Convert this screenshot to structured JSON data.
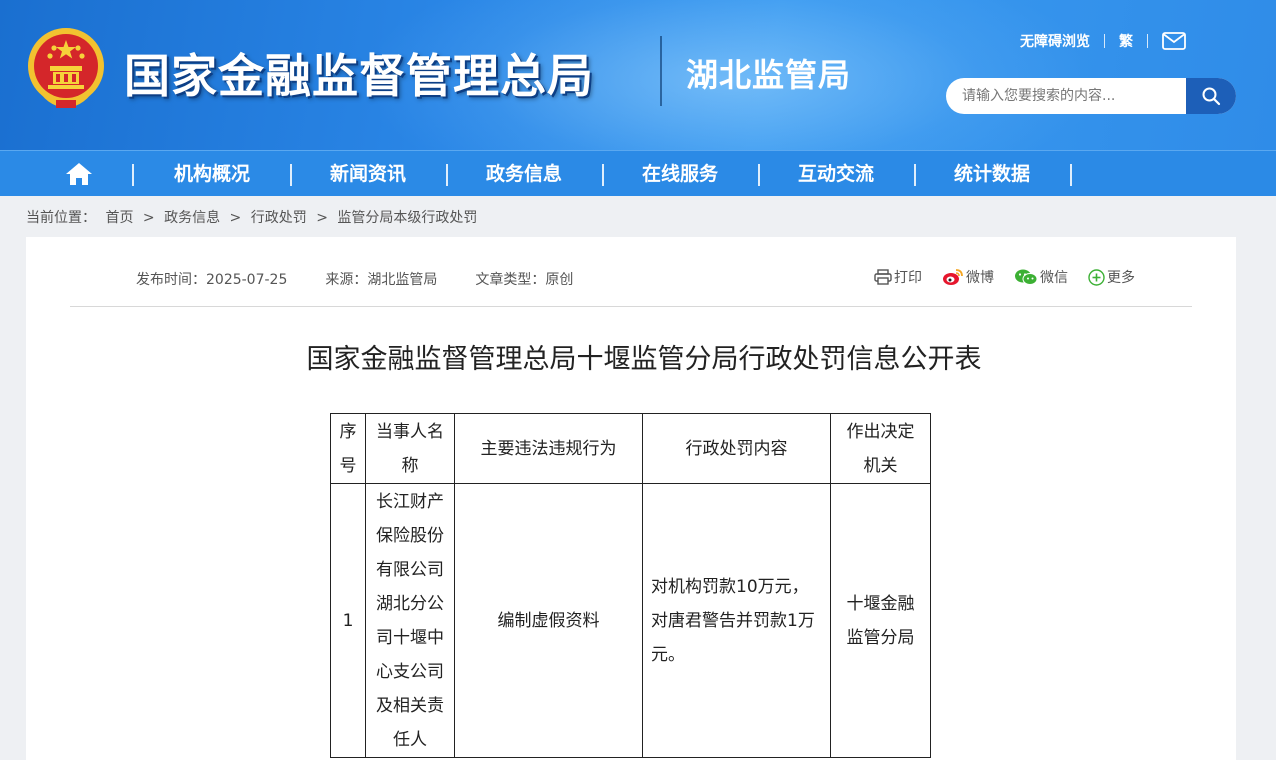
{
  "header": {
    "site_title": "国家金融监督管理总局",
    "sub_title": "湖北监管局",
    "accessibility_label": "无障碍浏览",
    "traditional_label": "繁",
    "search_placeholder": "请输入您要搜索的内容..."
  },
  "nav": {
    "items": [
      "机构概况",
      "新闻资讯",
      "政务信息",
      "在线服务",
      "互动交流",
      "统计数据"
    ]
  },
  "breadcrumb": {
    "label": "当前位置：",
    "items": [
      "首页",
      "政务信息",
      "行政处罚",
      "监管分局本级行政处罚"
    ],
    "separator": ">"
  },
  "article": {
    "publish_time": "发布时间：2025-07-25",
    "source": "来源：湖北监管局",
    "type": "文章类型：原创",
    "share": {
      "print": "打印",
      "weibo": "微博",
      "wechat": "微信",
      "more": "更多"
    },
    "title": "国家金融监督管理总局十堰监管分局行政处罚信息公开表"
  },
  "table": {
    "headers": [
      "序号",
      "当事人名称",
      "主要违法违规行为",
      "行政处罚内容",
      "作出决定机关"
    ],
    "rows": [
      {
        "index": "1",
        "party": "长江财产保险股份有限公司湖北分公司十堰中心支公司及相关责任人",
        "violation": "编制虚假资料",
        "penalty": "对机构罚款10万元，对唐君警告并罚款1万元。",
        "authority": "十堰金融监管分局"
      }
    ]
  },
  "colors": {
    "header_blue": "#2a86e6",
    "nav_blue": "#2b8ae6",
    "search_button": "#1d5fb8"
  }
}
